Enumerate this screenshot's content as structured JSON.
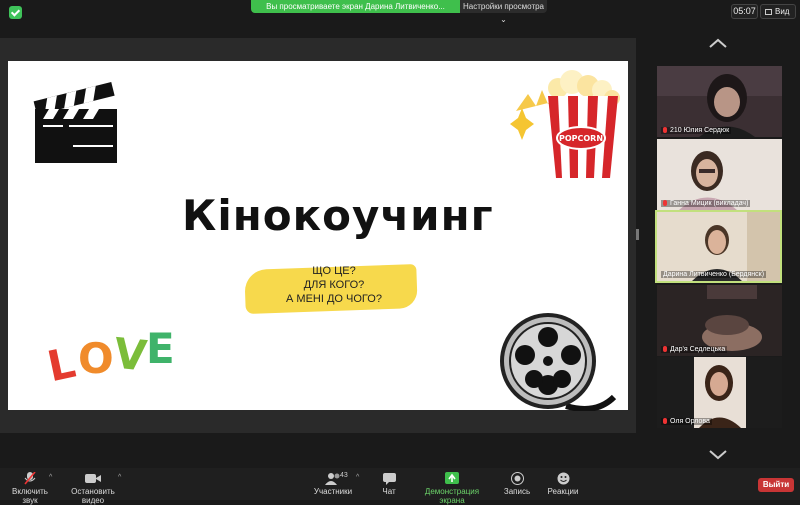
{
  "top": {
    "share_notice": "Вы просматриваете экран Дарина Литвиченко...",
    "view_options": "Настройки просмотра",
    "time": "05:07",
    "view": "Вид"
  },
  "slide": {
    "title": "Кінокоучинг",
    "questions": [
      "ЩО ЦЕ?",
      "ДЛЯ КОГО?",
      "А МЕНІ ДО ЧОГО?"
    ],
    "popcorn_label": "POPCORN",
    "love": [
      "L",
      "O",
      "V",
      "E"
    ]
  },
  "participants": [
    {
      "name": "210 Юлия Сердюк"
    },
    {
      "name": "Ганна Мицик (викладач)"
    },
    {
      "name": "Дарина Литвиченко (Бердянск)"
    },
    {
      "name": "Дар'я Седлецька"
    },
    {
      "name": "Оля Орлова"
    }
  ],
  "toolbar": {
    "unmute": "Включить звук",
    "stop_video": "Остановить видео",
    "participants": "Участники",
    "participants_count": "43",
    "chat": "Чат",
    "share_screen": "Демонстрация экрана",
    "record": "Запись",
    "reactions": "Реакции",
    "leave": "Выйти"
  },
  "colors": {
    "share_green": "#3fbf4c",
    "leave_red": "#c83535",
    "active_border": "#c2e07d",
    "highlight_yellow": "#f7d94c"
  }
}
